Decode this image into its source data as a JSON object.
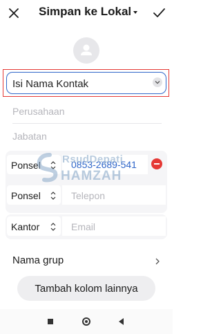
{
  "header": {
    "title": "Simpan ke Lokal",
    "close_icon": "close-icon",
    "confirm_icon": "check-icon"
  },
  "avatar": {
    "icon": "person-icon"
  },
  "name_field": {
    "placeholder": "Isi Nama Kontak"
  },
  "company": {
    "placeholder": "Perusahaan"
  },
  "job": {
    "placeholder": "Jabatan"
  },
  "phone1": {
    "label": "Ponsel",
    "value": "0853-2689-541"
  },
  "phone2": {
    "label": "Ponsel",
    "placeholder": "Telepon"
  },
  "email": {
    "label": "Kantor",
    "placeholder": "Email"
  },
  "group": {
    "label": "Nama grup"
  },
  "add_field_button": "Tambah kolom lainnya",
  "watermark": {
    "line1": "RsudDepati",
    "line2": "HAMZAH"
  },
  "colors": {
    "accent": "#2f66c9",
    "delete": "#e53935",
    "highlight_frame": "#e53935"
  }
}
